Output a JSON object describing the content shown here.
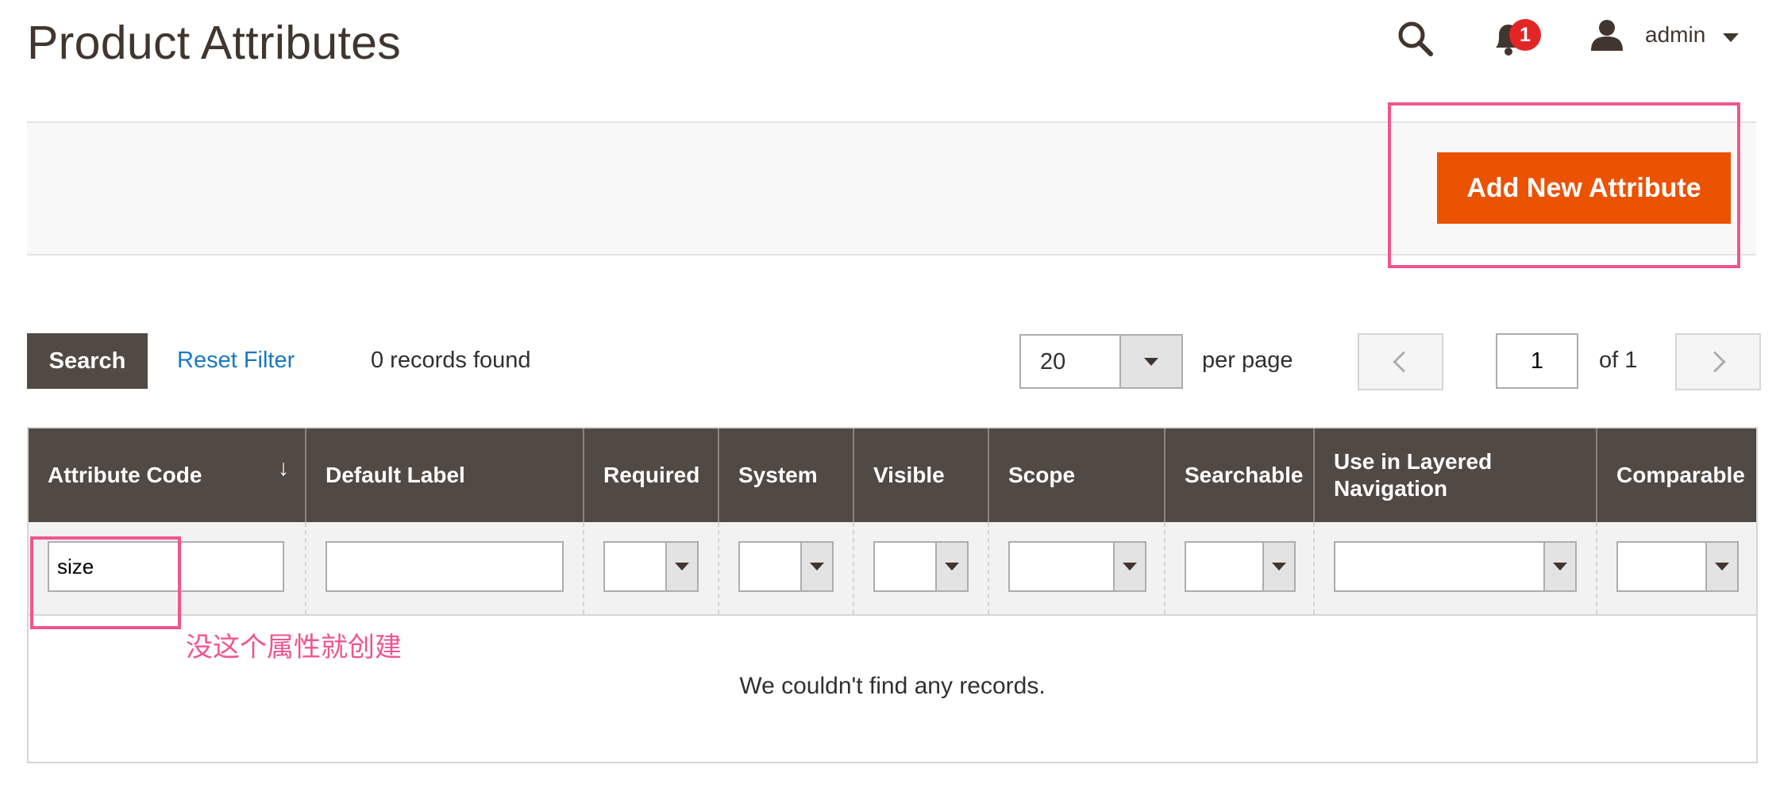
{
  "header": {
    "title": "Product Attributes",
    "notification_count": "1",
    "user_name": "admin"
  },
  "actions": {
    "add_new_label": "Add New Attribute"
  },
  "toolbar": {
    "search_label": "Search",
    "reset_label": "Reset Filter",
    "records_text": "0 records found",
    "per_page_value": "20",
    "per_page_label": "per page",
    "page_value": "1",
    "page_of": "of 1"
  },
  "grid": {
    "columns": [
      "Attribute Code",
      "Default Label",
      "Required",
      "System",
      "Visible",
      "Scope",
      "Searchable",
      "Use in Layered Navigation",
      "Comparable"
    ],
    "filters": {
      "attribute_code": "size"
    },
    "empty_message": "We couldn't find any records."
  },
  "annotation": {
    "text": "没这个属性就创建"
  },
  "colors": {
    "accent": "#eb5202",
    "header_bg": "#514943",
    "annotation": "#f0558e",
    "link": "#1979c3"
  }
}
